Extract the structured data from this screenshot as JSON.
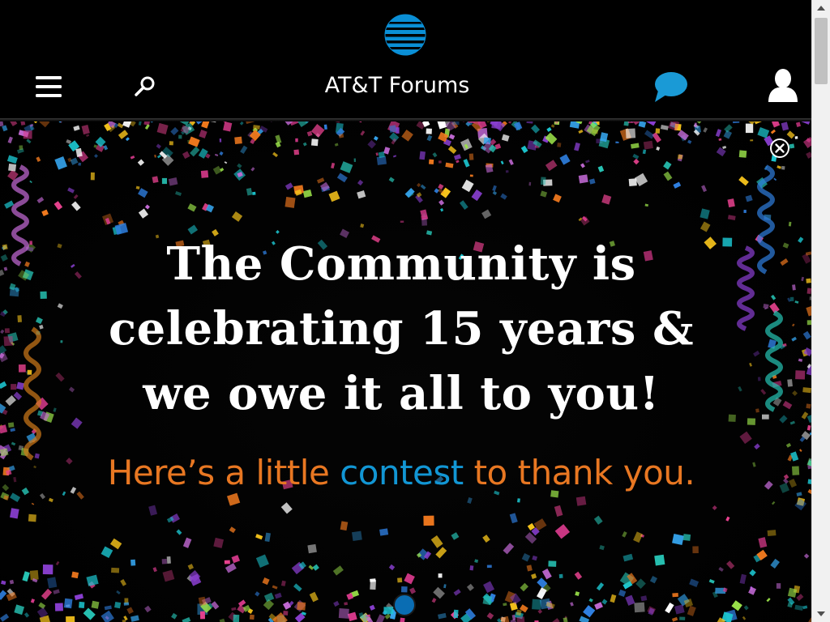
{
  "header": {
    "site_title": "AT&T Forums",
    "logo_icon": "att-globe-icon",
    "menu_icon": "hamburger-menu-icon",
    "search_icon": "search-icon",
    "chat_icon": "chat-bubble-icon",
    "user_icon": "user-profile-icon"
  },
  "banner": {
    "headline_line1": "The Community is",
    "headline_line2": "celebrating 15 years &",
    "headline_line3": "we owe it all to you!",
    "subline_part1": "Here’s a little ",
    "subline_link": "contest",
    "subline_part2": " to thank you.",
    "close_icon": "close-circle-icon",
    "carousel_slide_count": 1,
    "carousel_active_slide": 1
  },
  "colors": {
    "background": "#000000",
    "att_blue": "#1296d4",
    "chat_blue": "#1a9ad6",
    "orange": "#e87722",
    "dot_blue": "#0a6db3"
  }
}
